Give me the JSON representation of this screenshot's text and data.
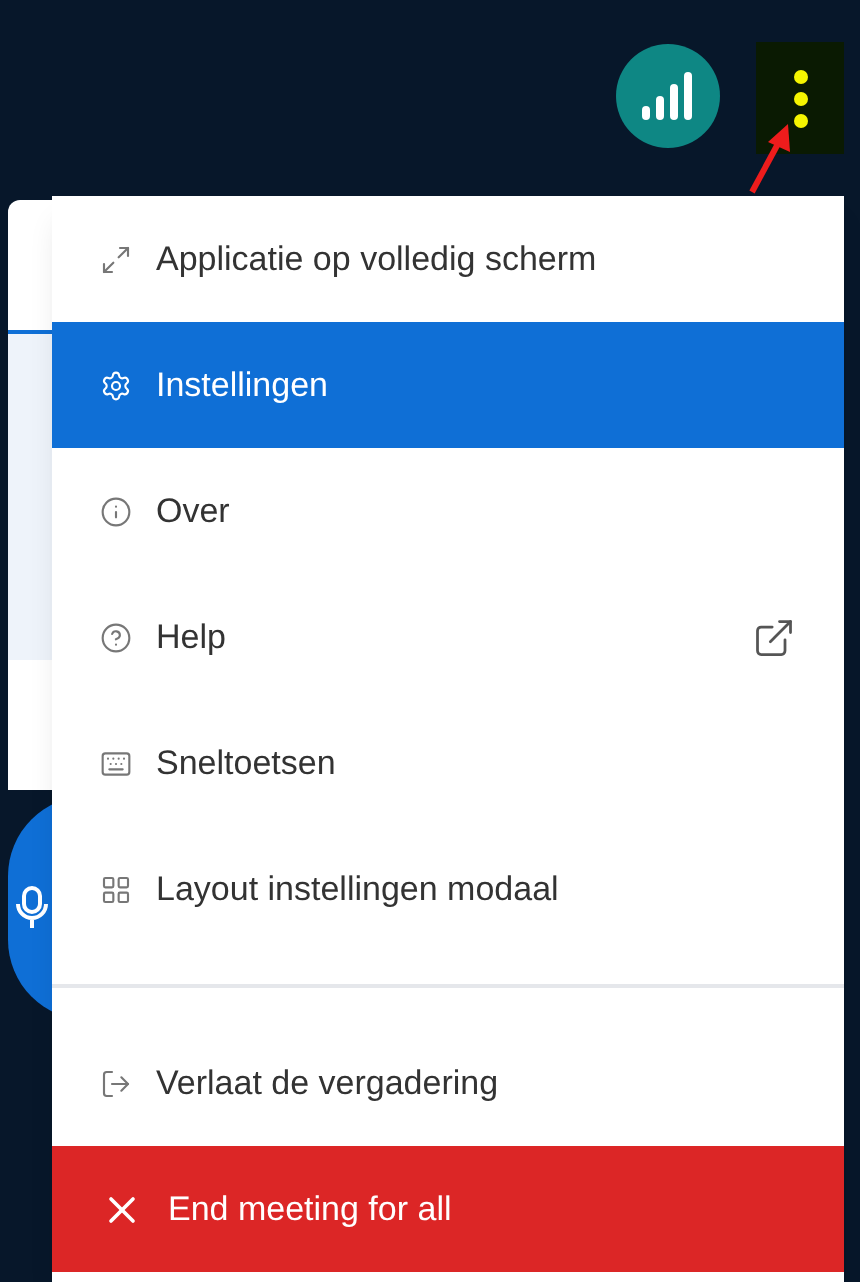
{
  "menu": {
    "items": [
      {
        "label": "Applicatie op volledig scherm",
        "kind": "normal",
        "selected": false,
        "external": false,
        "divider_before": false
      },
      {
        "label": "Instellingen",
        "kind": "normal",
        "selected": true,
        "external": false,
        "divider_before": false
      },
      {
        "label": "Over",
        "kind": "normal",
        "selected": false,
        "external": false,
        "divider_before": false
      },
      {
        "label": "Help",
        "kind": "normal",
        "selected": false,
        "external": true,
        "divider_before": false
      },
      {
        "label": "Sneltoetsen",
        "kind": "normal",
        "selected": false,
        "external": false,
        "divider_before": false
      },
      {
        "label": "Layout instellingen modaal",
        "kind": "normal",
        "selected": false,
        "external": false,
        "divider_before": false
      },
      {
        "label": "Verlaat de vergadering",
        "kind": "normal",
        "selected": false,
        "external": false,
        "divider_before": true
      },
      {
        "label": "End meeting for all",
        "kind": "danger",
        "selected": false,
        "external": false,
        "divider_before": false
      }
    ]
  }
}
